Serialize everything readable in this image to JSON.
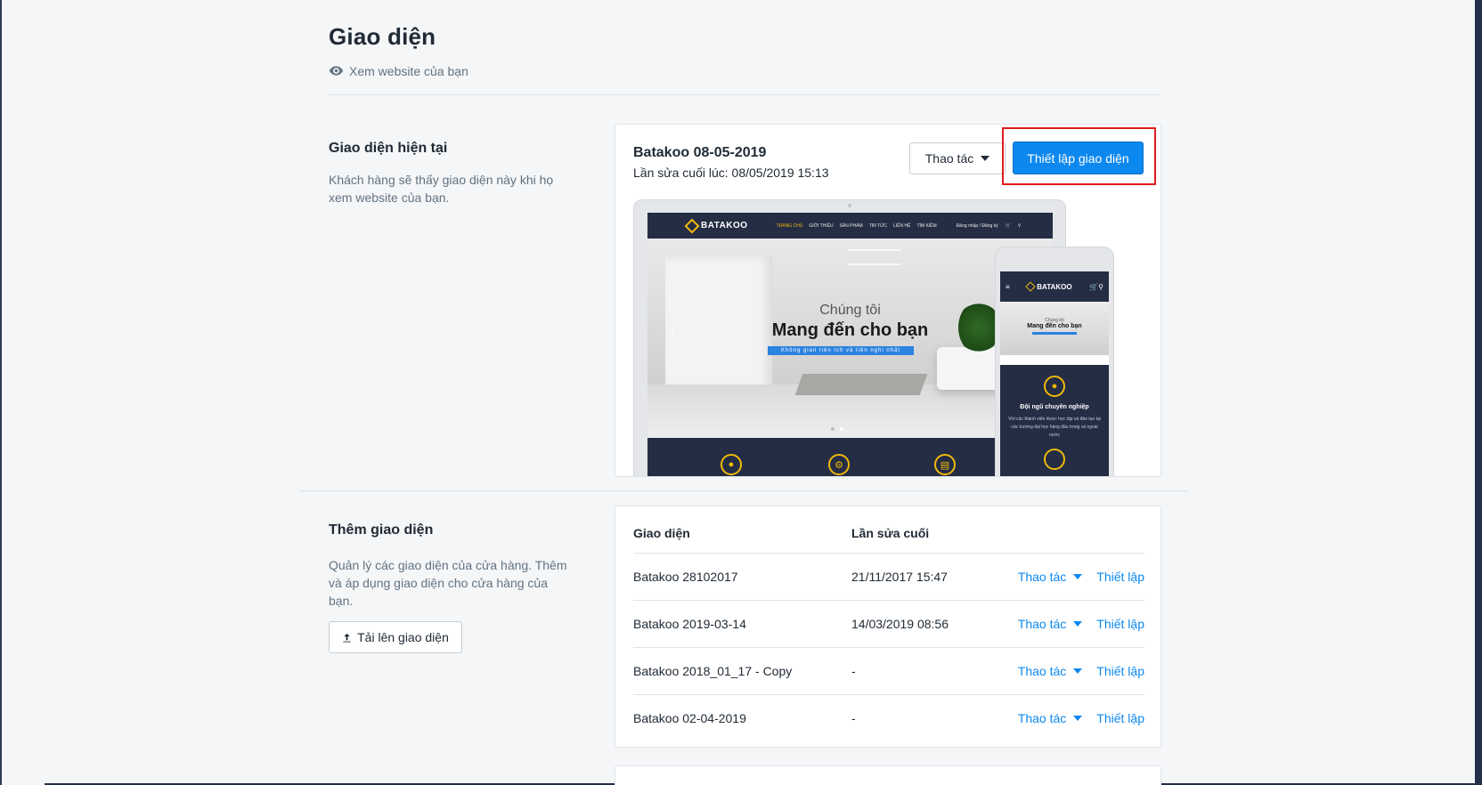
{
  "page": {
    "title": "Giao diện",
    "view_site_label": "Xem website của bạn"
  },
  "current_theme": {
    "section_title": "Giao diện hiện tại",
    "section_desc": "Khách hàng sẽ thấy giao diện này khi họ xem website của bạn.",
    "name": "Batakoo 08-05-2019",
    "last_edited": "Lần sửa cuối lúc: 08/05/2019 15:13",
    "actions_label": "Thao tác",
    "setup_label": "Thiết lập giao diện",
    "preview": {
      "logo": "BATAKOO",
      "nav": [
        "TRANG CHỦ",
        "GIỚI THIỆU",
        "SẢN PHẨM",
        "TIN TỨC",
        "LIÊN HỆ",
        "TÌM KIẾM"
      ],
      "nav_login": "Đăng nhập / Đăng ký",
      "hero_small": "Chúng tôi",
      "hero_big": "Mang đến cho bạn",
      "hero_bar": "Không gian tiện ích và tiện nghi nhất",
      "mobile_feature_title": "Đội ngũ chuyên nghiệp",
      "mobile_feature_desc": "Với các thành viên được học tập và đào tạo tại các trường đại học hàng đầu trong và ngoài nước"
    }
  },
  "themes": {
    "section_title": "Thêm giao diện",
    "section_desc": "Quản lý các giao diện của cửa hàng. Thêm và áp dụng giao diện cho cửa hàng của bạn.",
    "upload_label": "Tải lên giao diện",
    "columns": [
      "Giao diện",
      "Lần sửa cuối"
    ],
    "rows": [
      {
        "name": "Batakoo 28102017",
        "edited": "21/11/2017 15:47",
        "actions": "Thao tác",
        "setup": "Thiết lập"
      },
      {
        "name": "Batakoo 2019-03-14",
        "edited": "14/03/2019 08:56",
        "actions": "Thao tác",
        "setup": "Thiết lập"
      },
      {
        "name": "Batakoo 2018_01_17 - Copy",
        "edited": "-",
        "actions": "Thao tác",
        "setup": "Thiết lập"
      },
      {
        "name": "Batakoo 02-04-2019",
        "edited": "-",
        "actions": "Thao tác",
        "setup": "Thiết lập"
      }
    ]
  },
  "colors": {
    "primary": "#0d88ef",
    "background": "#f4f6f8",
    "highlight": "#e01b1b",
    "preview_dark": "#242d44",
    "preview_accent": "#f0b90b"
  }
}
